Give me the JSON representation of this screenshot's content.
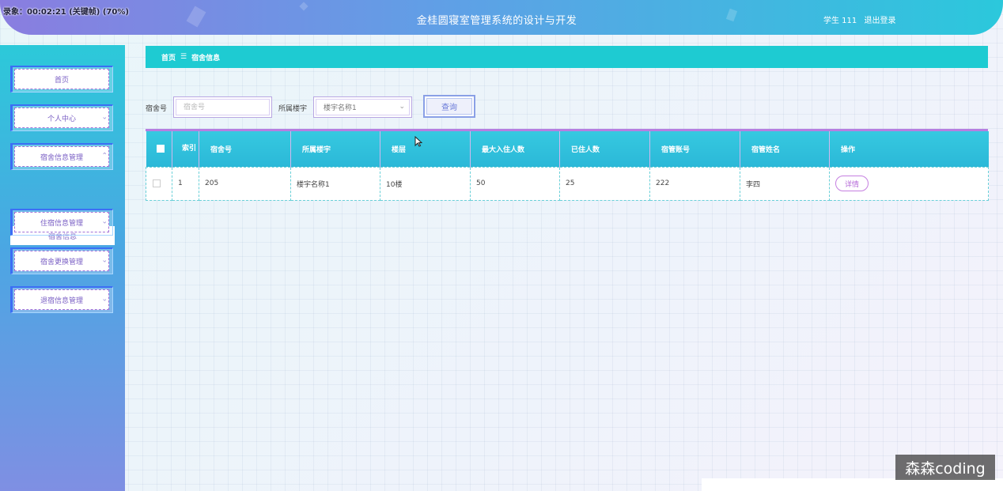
{
  "recording": {
    "label": "录象：00:02:21 (关键帧) (70%)"
  },
  "header": {
    "title": "金桂圆寝室管理系统的设计与开发",
    "user": "学生 111",
    "logout": "退出登录"
  },
  "sidebar": {
    "items": [
      {
        "label": "首页"
      },
      {
        "label": "个人中心"
      },
      {
        "label": "宿舍信息管理"
      },
      {
        "label": "住宿信息管理"
      },
      {
        "label": "宿舍更换管理"
      },
      {
        "label": "退宿信息管理"
      }
    ],
    "submenu": {
      "label": "宿舍信息"
    }
  },
  "breadcrumb": {
    "home": "首页",
    "separator": "☰",
    "current": "宿舍信息"
  },
  "search": {
    "dorm_label": "宿舍号",
    "dorm_placeholder": "宿舍号",
    "building_label": "所属楼宇",
    "building_value": "楼宇名称1",
    "query_button": "查询"
  },
  "table": {
    "headers": [
      "索引",
      "宿舍号",
      "所属楼宇",
      "楼层",
      "最大入住人数",
      "已住人数",
      "宿管账号",
      "宿管姓名",
      "操作"
    ],
    "rows": [
      {
        "index": "1",
        "dorm": "205",
        "building": "楼宇名称1",
        "floor": "10楼",
        "max": "50",
        "current": "25",
        "account": "222",
        "manager": "李四",
        "action": "详情"
      }
    ]
  },
  "watermark": "森森coding"
}
